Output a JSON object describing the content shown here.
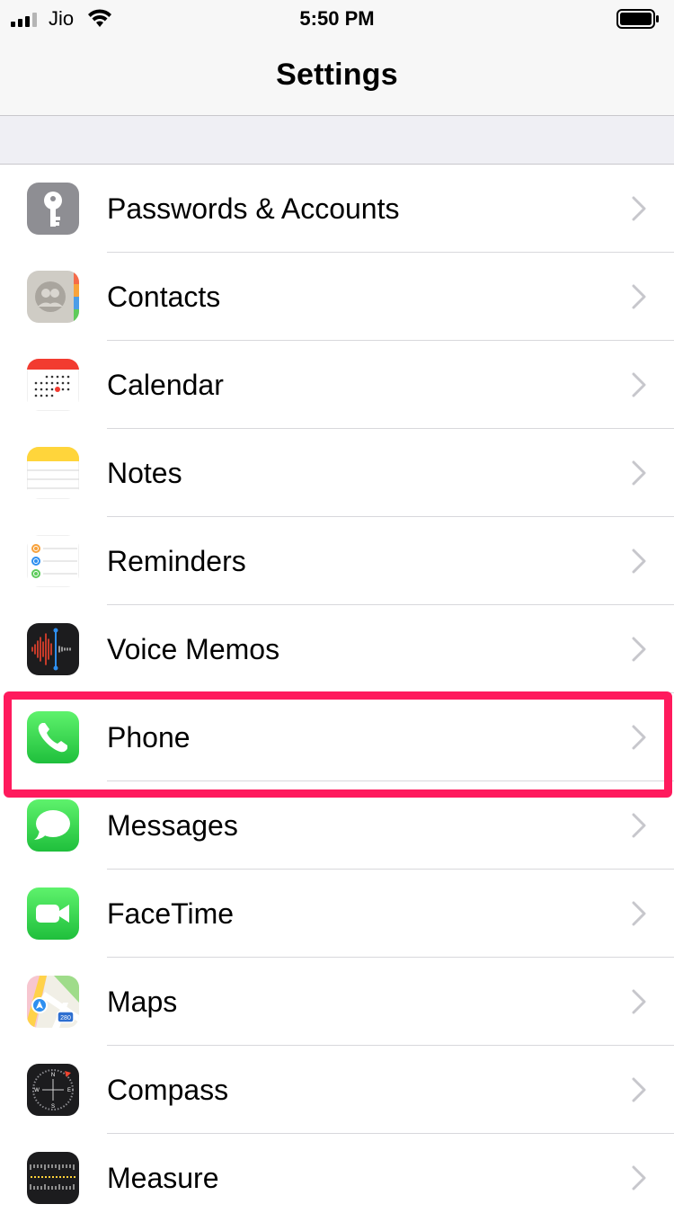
{
  "status_bar": {
    "carrier": "Jio",
    "time": "5:50 PM"
  },
  "nav": {
    "title": "Settings"
  },
  "items": [
    {
      "label": "Passwords & Accounts",
      "icon": "key-icon",
      "color": "#8e8e93"
    },
    {
      "label": "Contacts",
      "icon": "contacts-icon",
      "color": "#c9c7c2"
    },
    {
      "label": "Calendar",
      "icon": "calendar-icon",
      "color": "#ffffff"
    },
    {
      "label": "Notes",
      "icon": "notes-icon",
      "color": "#ffd53b"
    },
    {
      "label": "Reminders",
      "icon": "reminders-icon",
      "color": "#ffffff"
    },
    {
      "label": "Voice Memos",
      "icon": "voice-memos-icon",
      "color": "#1c1c1e"
    },
    {
      "label": "Phone",
      "icon": "phone-icon",
      "color": "#34c759"
    },
    {
      "label": "Messages",
      "icon": "messages-icon",
      "color": "#34c759"
    },
    {
      "label": "FaceTime",
      "icon": "facetime-icon",
      "color": "#34c759"
    },
    {
      "label": "Maps",
      "icon": "maps-icon",
      "color": "#f1efe6"
    },
    {
      "label": "Compass",
      "icon": "compass-icon",
      "color": "#1c1c1e"
    },
    {
      "label": "Measure",
      "icon": "measure-icon",
      "color": "#1c1c1e"
    }
  ],
  "highlight_color": "#ff1a5d"
}
